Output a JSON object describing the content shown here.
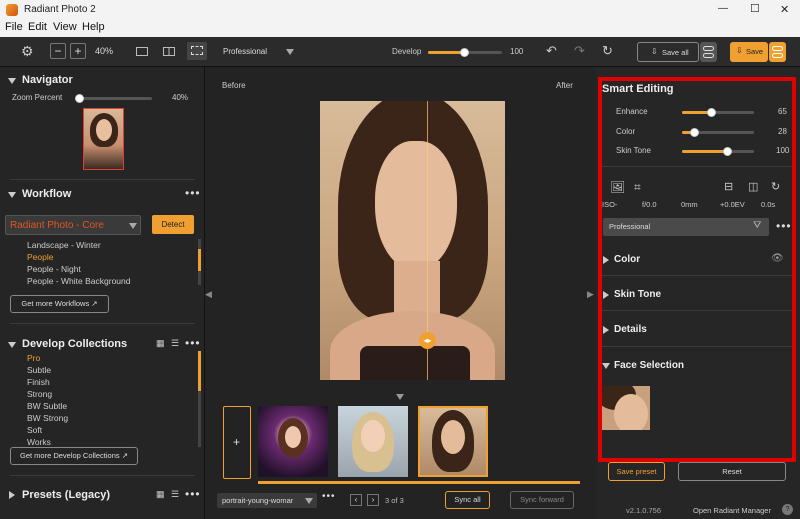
{
  "window": {
    "title": "Radiant Photo 2",
    "min": "—",
    "max": "☐",
    "close": "✕"
  },
  "menu": {
    "file": "File",
    "edit": "Edit",
    "view": "View",
    "help": "Help"
  },
  "toolbar": {
    "zoom_minus": "−",
    "zoom_plus": "+",
    "zoom": "40%",
    "preset": "Professional",
    "develop_label": "Develop",
    "develop_value": "100",
    "develop_level": 100,
    "save_all": "Save all",
    "save": "Save"
  },
  "navigator": {
    "title": "Navigator",
    "zoom_label": "Zoom Percent",
    "zoom_value": "40%",
    "zoom_level": 0.1
  },
  "workflow": {
    "title": "Workflow",
    "selected": "Radiant Photo - Core",
    "detect": "Detect",
    "items": [
      "Landscape - Winter",
      "People",
      "People - Night",
      "People - White Background"
    ],
    "get_more": "Get more Workflows"
  },
  "develop_collections": {
    "title": "Develop Collections",
    "items": [
      "Pro",
      "Subtle",
      "Finish",
      "Strong",
      "BW Subtle",
      "BW Strong",
      "Soft",
      "Works"
    ],
    "get_more": "Get more Develop Collections"
  },
  "presets": {
    "title": "Presets (Legacy)"
  },
  "center": {
    "before": "Before",
    "after": "After",
    "add": "+",
    "filename": "portrait-young-womar",
    "page": "3 of 3",
    "sync_all": "Sync all",
    "sync_forward": "Sync forward",
    "before_after_split": 0.5
  },
  "smart_editing": {
    "title": "Smart Editing",
    "sliders": [
      {
        "label": "Enhance",
        "value": "65",
        "level": 0.65
      },
      {
        "label": "Color",
        "value": "28",
        "level": 0.28
      },
      {
        "label": "Skin Tone",
        "value": "100",
        "level": 1.0
      }
    ],
    "meta": [
      "ISO-",
      "f/0.0",
      "0mm",
      "+0.0EV",
      "0.0s"
    ],
    "preset": "Professional",
    "sections": [
      "Color",
      "Skin Tone",
      "Details",
      "Face Selection"
    ]
  },
  "bottom": {
    "save_preset": "Save preset",
    "reset": "Reset",
    "version": "v2.1.0.756",
    "manager": "Open Radiant Manager",
    "help": "?"
  },
  "colors": {
    "accent": "#f0a030",
    "highlight_box": "#e00000",
    "bg": "#232323"
  }
}
